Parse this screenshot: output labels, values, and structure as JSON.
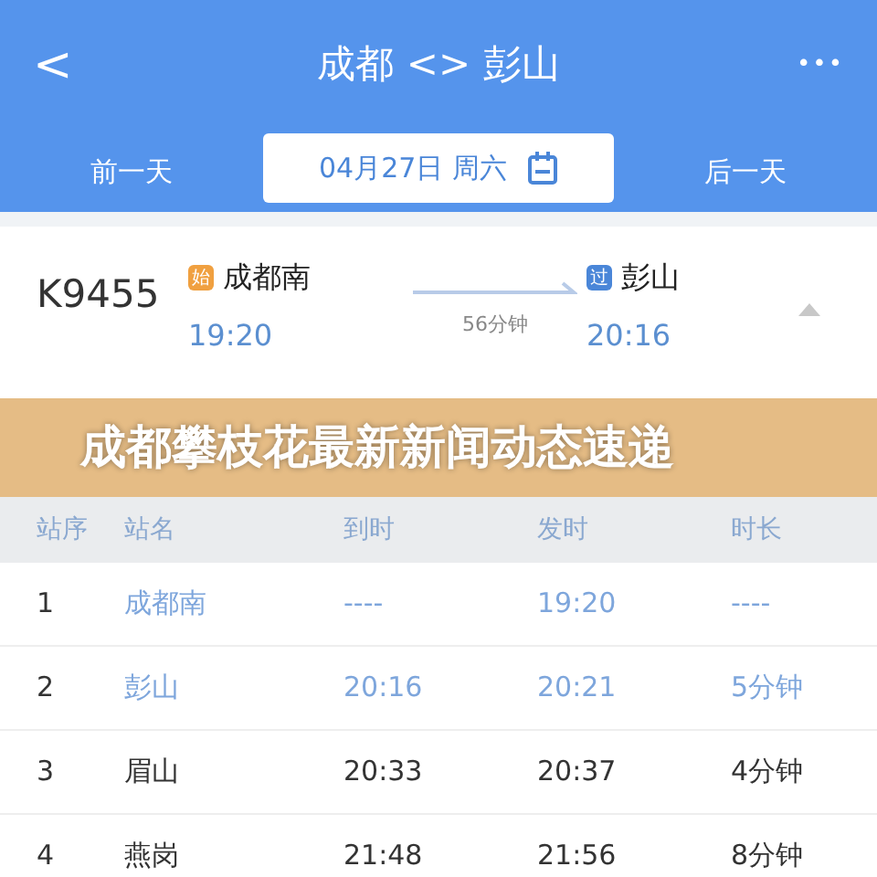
{
  "header": {
    "back": "<",
    "title": "成都 <> 彭山",
    "more": "•••"
  },
  "date_bar": {
    "prev": "前一天",
    "date": "04月27日 周六",
    "next": "后一天"
  },
  "train": {
    "number": "K9455",
    "from": {
      "badge": "始",
      "station": "成都南",
      "time": "19:20"
    },
    "duration": "56分钟",
    "to": {
      "badge": "过",
      "station": "彭山",
      "time": "20:16"
    },
    "expanded": true
  },
  "banner": {
    "text": "成都攀枝花最新新闻动态速递"
  },
  "table": {
    "columns": [
      "站序",
      "站名",
      "到时",
      "发时",
      "时长"
    ],
    "rows": [
      {
        "cells": [
          "1",
          "成都南",
          "----",
          "19:20",
          "----"
        ],
        "highlighted": true
      },
      {
        "cells": [
          "2",
          "彭山",
          "20:16",
          "20:21",
          "5分钟"
        ],
        "highlighted": true
      },
      {
        "cells": [
          "3",
          "眉山",
          "20:33",
          "20:37",
          "4分钟"
        ],
        "highlighted": false
      },
      {
        "cells": [
          "4",
          "燕岗",
          "21:48",
          "21:56",
          "8分钟"
        ],
        "highlighted": false
      }
    ]
  }
}
